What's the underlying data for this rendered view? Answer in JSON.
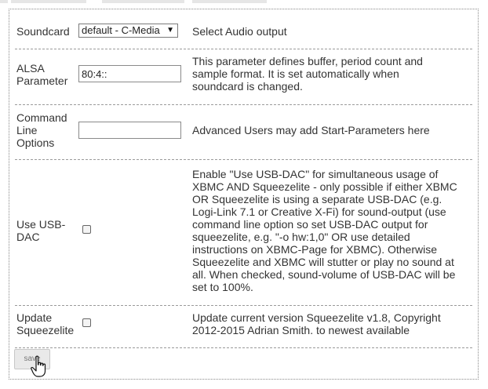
{
  "settings": {
    "soundcard": {
      "label": "Soundcard",
      "selected": "default - C-Media",
      "description": "Select Audio output"
    },
    "alsa": {
      "label_line1": "ALSA",
      "label_line2": "Parameter",
      "value": "80:4::",
      "desc_line1": "This parameter defines buffer, period count and",
      "desc_line2": "sample format. It is set automatically when",
      "desc_line3": "soundcard is changed."
    },
    "cmdline": {
      "label_line1": "Command",
      "label_line2": "Line",
      "label_line3": "Options",
      "value": "",
      "description": "Advanced Users may add Start-Parameters here"
    },
    "usbdac": {
      "label_line1": "Use USB-",
      "label_line2": "DAC",
      "checked": false,
      "desc_lines": [
        "Enable \"Use USB-DAC\" for simultaneous usage of",
        "XBMC AND Squeezelite - only possible if either XBMC",
        "OR Squeezelite is using a separate USB-DAC (e.g.",
        "Logi-Link 7.1 or Creative X-Fi) for sound-output (use",
        "command line option so set USB-DAC output for",
        "squeezelite, e.g. \"-o hw:1,0\" OR use detailed",
        "instructions on XBMC-Page for XBMC). Otherwise",
        "Squeezelite and XBMC will stutter or play no sound at",
        "all. When checked, sound-volume of USB-DAC will be",
        "set to 100%."
      ]
    },
    "update": {
      "label_line1": "Update",
      "label_line2": "Squeezelite",
      "checked": false,
      "desc_line1": "Update current version Squeezelite v1.8, Copyright",
      "desc_line2": "2012-2015 Adrian Smith. to newest available"
    }
  },
  "footer": {
    "save_label": "save"
  },
  "colors": {
    "border": "#8a8a8a",
    "text": "#333333",
    "button_bg": "#e9e9e9"
  }
}
